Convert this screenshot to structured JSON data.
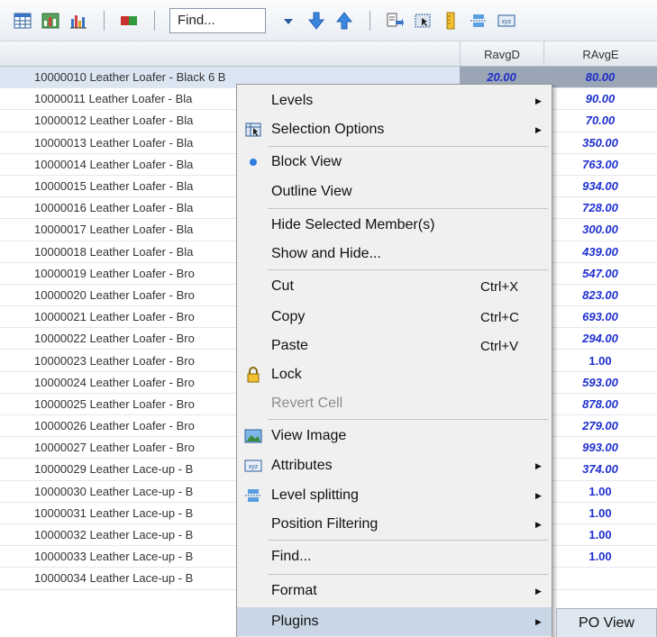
{
  "toolbar": {
    "find_label": "Find...",
    "icons": [
      "grid-icon",
      "chart-image-icon",
      "bar-chart-icon",
      "color-block-icon",
      "dropdown-arrow-icon",
      "download-arrow-icon",
      "upload-arrow-icon",
      "export-icon",
      "selection-icon",
      "ruler-icon",
      "level-split-icon",
      "attributes-icon"
    ]
  },
  "columns": [
    "RavgD",
    "RAvgE"
  ],
  "rows": [
    {
      "name": "10000010 Leather Loafer - Black 6 B",
      "v1": "20.00",
      "v2": "80.00"
    },
    {
      "name": "10000011 Leather Loafer - Bla",
      "v1": "",
      "v2": "90.00"
    },
    {
      "name": "10000012 Leather Loafer - Bla",
      "v1": "",
      "v2": "70.00"
    },
    {
      "name": "10000013 Leather Loafer - Bla",
      "v1": "",
      "v2": "350.00"
    },
    {
      "name": "10000014 Leather Loafer - Bla",
      "v1": "",
      "v2": "763.00"
    },
    {
      "name": "10000015 Leather Loafer - Bla",
      "v1": "",
      "v2": "934.00"
    },
    {
      "name": "10000016 Leather Loafer - Bla",
      "v1": "",
      "v2": "728.00"
    },
    {
      "name": "10000017 Leather Loafer - Bla",
      "v1": "",
      "v2": "300.00"
    },
    {
      "name": "10000018 Leather Loafer - Bla",
      "v1": "",
      "v2": "439.00"
    },
    {
      "name": "10000019 Leather Loafer - Bro",
      "v1": "",
      "v2": "547.00"
    },
    {
      "name": "10000020 Leather Loafer - Bro",
      "v1": "",
      "v2": "823.00"
    },
    {
      "name": "10000021 Leather Loafer - Bro",
      "v1": "",
      "v2": "693.00"
    },
    {
      "name": "10000022 Leather Loafer - Bro",
      "v1": "",
      "v2": "294.00"
    },
    {
      "name": "10000023 Leather Loafer - Bro",
      "v1": "",
      "v2": "1.00"
    },
    {
      "name": "10000024 Leather Loafer - Bro",
      "v1": "",
      "v2": "593.00"
    },
    {
      "name": "10000025 Leather Loafer - Bro",
      "v1": "",
      "v2": "878.00"
    },
    {
      "name": "10000026 Leather Loafer - Bro",
      "v1": "",
      "v2": "279.00"
    },
    {
      "name": "10000027 Leather Loafer - Bro",
      "v1": "",
      "v2": "993.00"
    },
    {
      "name": "10000029 Leather Lace-up - B",
      "v1": "",
      "v2": "374.00"
    },
    {
      "name": "10000030 Leather Lace-up - B",
      "v1": "",
      "v2": "1.00"
    },
    {
      "name": "10000031 Leather Lace-up - B",
      "v1": "",
      "v2": "1.00"
    },
    {
      "name": "10000032 Leather Lace-up - B",
      "v1": "",
      "v2": "1.00"
    },
    {
      "name": "10000033 Leather Lace-up - B",
      "v1": "",
      "v2": "1.00"
    },
    {
      "name": "10000034 Leather Lace-up - B",
      "v1": "",
      "v2": ""
    }
  ],
  "menu": {
    "levels": "Levels",
    "selection_options": "Selection Options",
    "block_view": "Block View",
    "outline_view": "Outline View",
    "hide_selected": "Hide Selected Member(s)",
    "show_hide": "Show and Hide...",
    "cut": "Cut",
    "cut_sc": "Ctrl+X",
    "copy": "Copy",
    "copy_sc": "Ctrl+C",
    "paste": "Paste",
    "paste_sc": "Ctrl+V",
    "lock": "Lock",
    "revert": "Revert Cell",
    "view_image": "View Image",
    "attributes": "Attributes",
    "level_splitting": "Level splitting",
    "position_filtering": "Position Filtering",
    "find": "Find...",
    "format": "Format",
    "plugins": "Plugins"
  },
  "submenu": {
    "po_view": "PO View"
  },
  "colors": {
    "accent": "#2b2bd6",
    "selection": "#dce6f2",
    "menu_bg": "#f0f0f0",
    "highlight": "#c9d6e6"
  }
}
